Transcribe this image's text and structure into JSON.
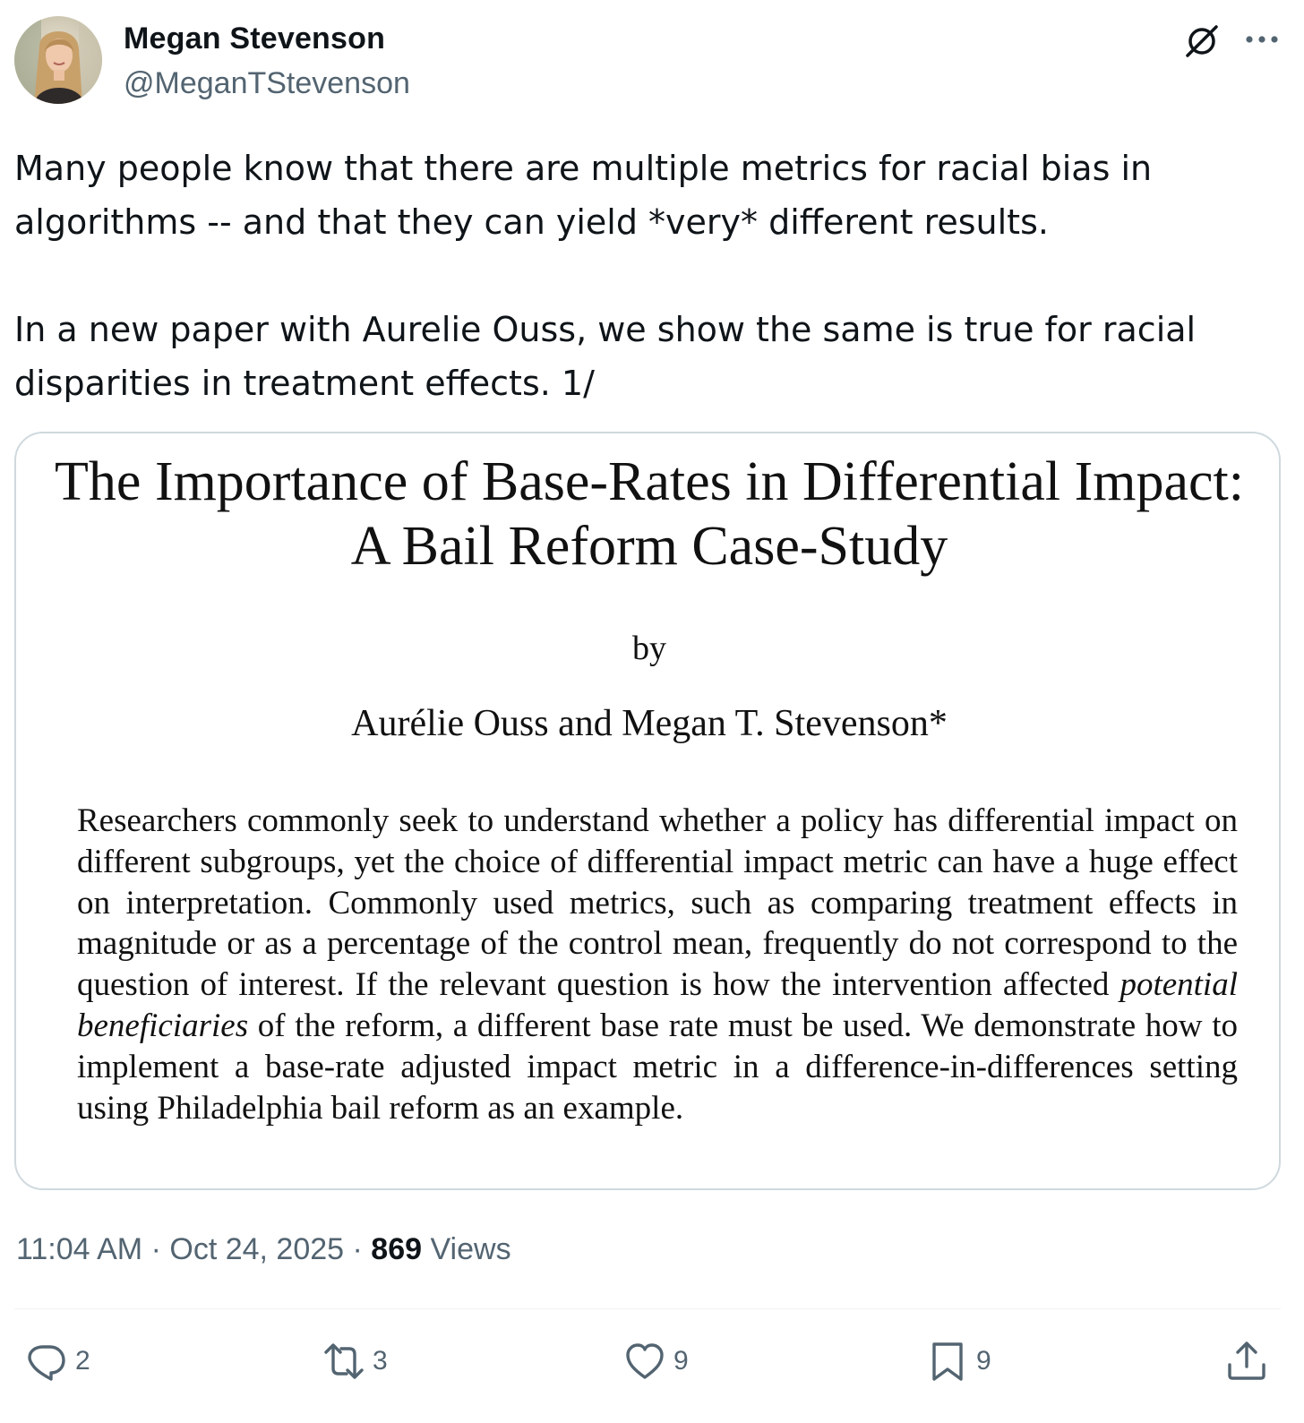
{
  "author": {
    "name": "Megan Stevenson",
    "handle": "@MeganTStevenson"
  },
  "tweet": {
    "paragraphs": [
      "Many people know that there are multiple metrics for racial bias in algorithms -- and that they can yield *very* different results.",
      "In a new paper with Aurelie Ouss, we show the same is true for racial disparities in treatment effects. 1/"
    ]
  },
  "media": {
    "title_line1": "The Importance of Base-Rates in Differential Impact:",
    "title_line2": "A Bail Reform Case-Study",
    "by": "by",
    "authors": "Aurélie Ouss and Megan T. Stevenson*",
    "abstract_before_italic": "Researchers commonly seek to understand whether a policy has differential impact on different subgroups, yet the choice of differential impact metric can have a huge effect on interpretation. Commonly used metrics, such as comparing treatment effects in magnitude or as a percentage of the control mean, frequently do not correspond to the question of interest. If the relevant question is how the intervention affected ",
    "abstract_italic": "potential beneficiaries",
    "abstract_after_italic": " of the reform, a different base rate must be used. We demonstrate how to implement a base-rate adjusted impact metric in a difference-in-differences setting using Philadelphia bail reform as an example."
  },
  "meta": {
    "time": "11:04 AM",
    "separator": "·",
    "date": "Oct 24, 2025",
    "views_count": "869",
    "views_label": "Views"
  },
  "actions": {
    "replies": "2",
    "reposts": "3",
    "likes": "9",
    "bookmarks": "9"
  },
  "colors": {
    "text_primary": "#0f1419",
    "text_secondary": "#536471",
    "border": "#cfd9de"
  }
}
